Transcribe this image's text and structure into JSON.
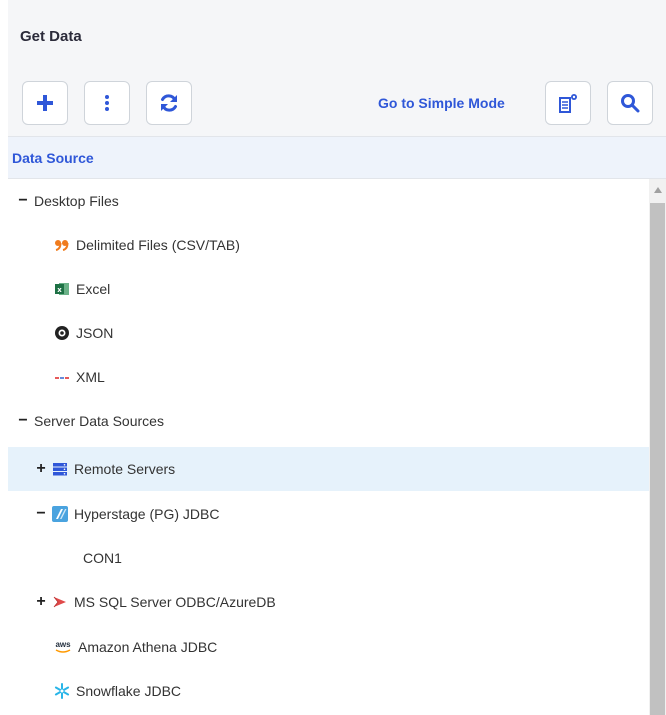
{
  "panel": {
    "title": "Get Data"
  },
  "toolbar": {
    "add_icon": "plus-icon",
    "more_icon": "vertical-dots-icon",
    "refresh_icon": "refresh-icon",
    "simple_mode_label": "Go to Simple Mode",
    "settings_icon": "data-settings-icon",
    "search_icon": "search-icon"
  },
  "section": {
    "label": "Data Source"
  },
  "tree": {
    "desktop": {
      "label": "Desktop Files",
      "toggle": "−",
      "items": [
        {
          "label": "Delimited Files (CSV/TAB)",
          "icon": "quote-icon"
        },
        {
          "label": "Excel",
          "icon": "excel-icon"
        },
        {
          "label": "JSON",
          "icon": "json-icon"
        },
        {
          "label": "XML",
          "icon": "xml-icon"
        }
      ]
    },
    "server": {
      "label": "Server Data Sources",
      "toggle": "−",
      "remote": {
        "label": "Remote Servers",
        "toggle": "+",
        "icon": "server-stack-icon"
      },
      "hyperstage": {
        "label": "Hyperstage (PG) JDBC",
        "toggle": "−",
        "icon": "hyperstage-icon",
        "children": [
          {
            "label": "CON1"
          }
        ]
      },
      "mssql": {
        "label": "MS SQL Server ODBC/AzureDB",
        "toggle": "+",
        "icon": "sql-server-icon"
      },
      "athena": {
        "label": "Amazon Athena JDBC",
        "icon": "aws-icon",
        "icon_text": "aws"
      },
      "snowflake": {
        "label": "Snowflake JDBC",
        "icon": "snowflake-icon"
      }
    }
  },
  "colors": {
    "accent": "#2f57d8",
    "selected_row": "#e6f2fb",
    "header_bg": "#f5f6f8",
    "section_bg": "#eef3fb"
  }
}
